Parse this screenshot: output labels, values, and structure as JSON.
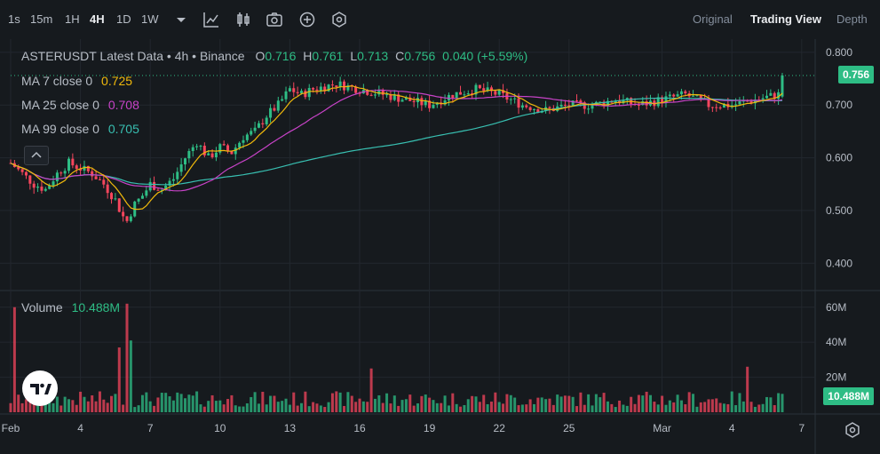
{
  "toolbar": {
    "timeframes": [
      "1s",
      "15m",
      "1H",
      "4H",
      "1D",
      "1W"
    ],
    "active": "4H",
    "icons": [
      "chevron-down-icon",
      "indicator-icon",
      "candle-type-icon",
      "camera-icon",
      "add-icon",
      "settings-icon"
    ],
    "views": [
      "Original",
      "Trading View",
      "Depth"
    ],
    "active_view": "Trading View"
  },
  "legend": {
    "title": "ASTERUSDT Latest Data • 4h • Binance",
    "o_label": "O",
    "o": "0.716",
    "h_label": "H",
    "h": "0.761",
    "l_label": "L",
    "l": "0.713",
    "c_label": "C",
    "c": "0.756",
    "change": "0.040 (+5.59%)",
    "ma7_label": "MA 7 close 0",
    "ma7": "0.725",
    "ma25_label": "MA 25 close 0",
    "ma25": "0.708",
    "ma99_label": "MA 99 close 0",
    "ma99": "0.705",
    "volume_label": "Volume",
    "volume": "10.488M"
  },
  "last_price": "0.756",
  "last_volume": "10.488M",
  "colors": {
    "up": "#2ebd85",
    "down": "#f6465d",
    "ma7": "#f0b90b",
    "ma25": "#c843c8",
    "ma99": "#38bfb1",
    "bg": "#161a1e"
  },
  "chart_data": {
    "type": "candlestick",
    "symbol": "ASTERUSDT",
    "interval": "4h",
    "exchange": "Binance",
    "price_axis_ticks": [
      "0.800",
      "0.700",
      "0.600",
      "0.500",
      "0.400"
    ],
    "price_range": [
      0.36,
      0.82
    ],
    "volume_axis_ticks": [
      "60M",
      "40M",
      "20M"
    ],
    "volume_range": [
      0,
      68
    ],
    "x_ticks": [
      "Feb",
      "4",
      "7",
      "10",
      "13",
      "16",
      "19",
      "22",
      "25",
      "Mar",
      "4",
      "7"
    ],
    "x_tick_days": [
      1,
      4,
      7,
      10,
      13,
      16,
      19,
      22,
      25,
      29,
      32,
      35
    ],
    "series_close_by_day": [
      [
        1.0,
        0.59
      ],
      [
        1.5,
        0.57
      ],
      [
        2.0,
        0.55
      ],
      [
        2.5,
        0.54
      ],
      [
        3.0,
        0.57
      ],
      [
        3.5,
        0.59
      ],
      [
        4.0,
        0.58
      ],
      [
        4.5,
        0.57
      ],
      [
        5.0,
        0.55
      ],
      [
        5.5,
        0.52
      ],
      [
        5.8,
        0.49
      ],
      [
        6.0,
        0.48
      ],
      [
        6.3,
        0.51
      ],
      [
        6.7,
        0.53
      ],
      [
        7.0,
        0.55
      ],
      [
        7.5,
        0.54
      ],
      [
        8.0,
        0.56
      ],
      [
        8.5,
        0.6
      ],
      [
        9.0,
        0.63
      ],
      [
        9.5,
        0.6
      ],
      [
        10.0,
        0.62
      ],
      [
        10.5,
        0.61
      ],
      [
        11.0,
        0.64
      ],
      [
        11.5,
        0.65
      ],
      [
        12.0,
        0.68
      ],
      [
        12.5,
        0.7
      ],
      [
        13.0,
        0.73
      ],
      [
        13.5,
        0.72
      ],
      [
        14.0,
        0.73
      ],
      [
        15.0,
        0.74
      ],
      [
        16.0,
        0.73
      ],
      [
        17.0,
        0.72
      ],
      [
        18.0,
        0.71
      ],
      [
        19.0,
        0.7
      ],
      [
        20.0,
        0.72
      ],
      [
        21.0,
        0.73
      ],
      [
        22.0,
        0.72
      ],
      [
        23.0,
        0.7
      ],
      [
        24.0,
        0.69
      ],
      [
        25.0,
        0.7
      ],
      [
        26.0,
        0.7
      ],
      [
        27.0,
        0.71
      ],
      [
        28.0,
        0.7
      ],
      [
        29.0,
        0.71
      ],
      [
        30.0,
        0.72
      ],
      [
        31.0,
        0.7
      ],
      [
        32.0,
        0.7
      ],
      [
        33.0,
        0.71
      ],
      [
        34.0,
        0.72
      ],
      [
        34.3,
        0.756
      ]
    ],
    "volume_spikes_m": [
      [
        1.2,
        60
      ],
      [
        5.7,
        37
      ],
      [
        6.0,
        62
      ],
      [
        6.2,
        41
      ],
      [
        16.5,
        25
      ],
      [
        32.6,
        26
      ]
    ],
    "ma_lines": [
      "MA 7",
      "MA 25",
      "MA 99"
    ]
  }
}
